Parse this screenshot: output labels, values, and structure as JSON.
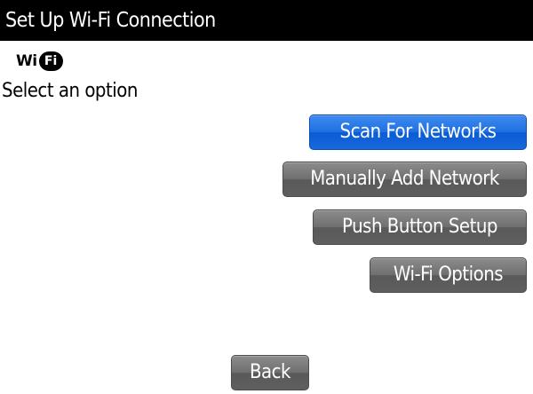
{
  "header": {
    "title": "Set Up Wi-Fi Connection"
  },
  "logo": {
    "wi": "Wi",
    "fi": "Fi",
    "icon": "wifi-logo"
  },
  "prompt": "Select an option",
  "options": [
    {
      "label": "Scan For Networks",
      "selected": true
    },
    {
      "label": "Manually Add Network",
      "selected": false
    },
    {
      "label": "Push Button Setup",
      "selected": false
    },
    {
      "label": "Wi-Fi Options",
      "selected": false
    }
  ],
  "back_label": "Back",
  "colors": {
    "selected_button": "#1f6fe0",
    "button": "#6f6f6f",
    "title_bar": "#000000"
  }
}
